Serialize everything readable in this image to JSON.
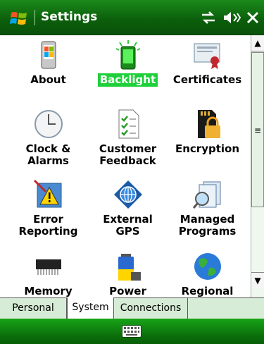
{
  "titlebar": {
    "title": "Settings",
    "status_icons": [
      "connectivity-icon",
      "volume-icon",
      "close-icon"
    ]
  },
  "items": [
    {
      "label": "About",
      "icon": "about-icon",
      "selected": false
    },
    {
      "label": "Backlight",
      "icon": "backlight-icon",
      "selected": true
    },
    {
      "label": "Certificates",
      "icon": "certificates-icon",
      "selected": false
    },
    {
      "label": "Clock &\nAlarms",
      "icon": "clock-icon",
      "selected": false
    },
    {
      "label": "Customer\nFeedback",
      "icon": "customer-feedback-icon",
      "selected": false
    },
    {
      "label": "Encryption",
      "icon": "encryption-icon",
      "selected": false
    },
    {
      "label": "Error\nReporting",
      "icon": "error-reporting-icon",
      "selected": false
    },
    {
      "label": "External\nGPS",
      "icon": "external-gps-icon",
      "selected": false
    },
    {
      "label": "Managed\nPrograms",
      "icon": "managed-programs-icon",
      "selected": false
    },
    {
      "label": "Memory",
      "icon": "memory-icon",
      "selected": false
    },
    {
      "label": "Power",
      "icon": "power-icon",
      "selected": false
    },
    {
      "label": "Regional",
      "icon": "regional-icon",
      "selected": false
    }
  ],
  "tabs": [
    {
      "label": "Personal",
      "active": false
    },
    {
      "label": "System",
      "active": true
    },
    {
      "label": "Connections",
      "active": false
    }
  ],
  "colors": {
    "titlebar": "#0b5d0b",
    "selection": "#1fcf3a",
    "tabbar": "#d6ecd6"
  }
}
